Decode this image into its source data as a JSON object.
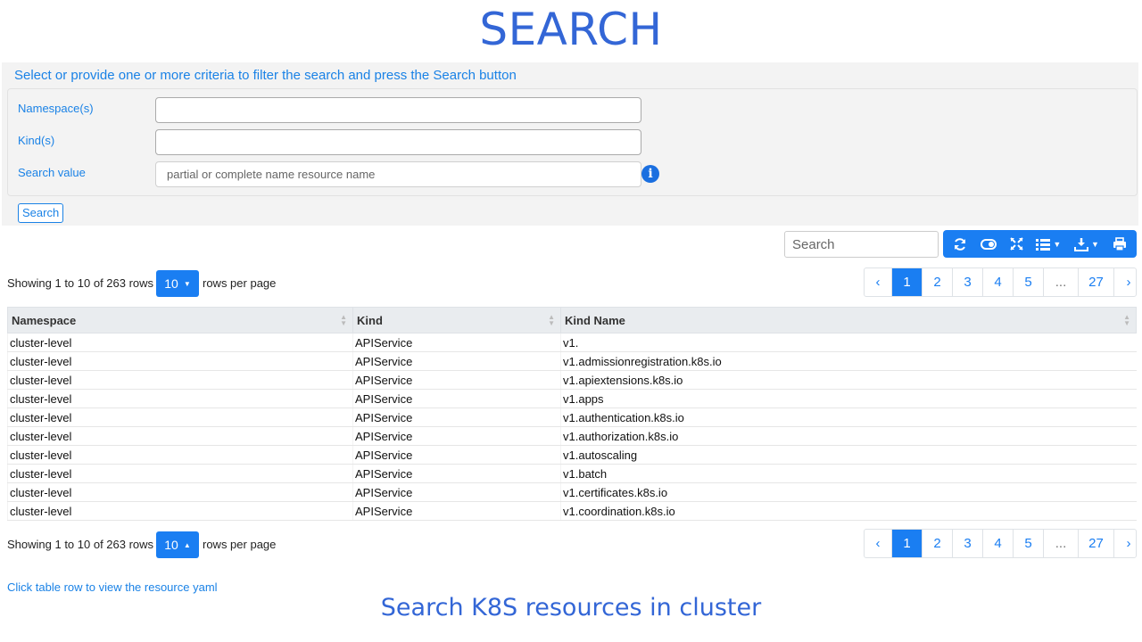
{
  "page": {
    "title": "SEARCH",
    "caption": "Search K8S resources in cluster"
  },
  "criteria": {
    "hint": "Select or provide one or more criteria to filter the search and press the Search button",
    "namespace_label": "Namespace(s)",
    "namespace_value": "",
    "kind_label": "Kind(s)",
    "kind_value": "",
    "search_value_label": "Search value",
    "search_value_placeholder": "partial or complete name resource name",
    "info_icon": "i",
    "search_button": "Search"
  },
  "toolbar": {
    "search_placeholder": "Search",
    "buttons": [
      "refresh-icon",
      "toggle-icon",
      "fullscreen-icon",
      "columns-icon",
      "export-icon",
      "print-icon"
    ],
    "accent": "#1a7ef2"
  },
  "pagination_top": {
    "info": "Showing 1 to 10 of 263 rows",
    "page_size": "10",
    "suffix": "rows per page",
    "pages": [
      "‹",
      "1",
      "2",
      "3",
      "4",
      "5",
      "...",
      "27",
      "›"
    ],
    "active_page": "1"
  },
  "pagination_bottom": {
    "info": "Showing 1 to 10 of 263 rows",
    "page_size": "10",
    "suffix": "rows per page",
    "pages": [
      "‹",
      "1",
      "2",
      "3",
      "4",
      "5",
      "...",
      "27",
      "›"
    ],
    "active_page": "1"
  },
  "table": {
    "headers": [
      "Namespace",
      "Kind",
      "Kind Name"
    ],
    "rows": [
      [
        "cluster-level",
        "APIService",
        "v1."
      ],
      [
        "cluster-level",
        "APIService",
        "v1.admissionregistration.k8s.io"
      ],
      [
        "cluster-level",
        "APIService",
        "v1.apiextensions.k8s.io"
      ],
      [
        "cluster-level",
        "APIService",
        "v1.apps"
      ],
      [
        "cluster-level",
        "APIService",
        "v1.authentication.k8s.io"
      ],
      [
        "cluster-level",
        "APIService",
        "v1.authorization.k8s.io"
      ],
      [
        "cluster-level",
        "APIService",
        "v1.autoscaling"
      ],
      [
        "cluster-level",
        "APIService",
        "v1.batch"
      ],
      [
        "cluster-level",
        "APIService",
        "v1.certificates.k8s.io"
      ],
      [
        "cluster-level",
        "APIService",
        "v1.coordination.k8s.io"
      ]
    ]
  },
  "footnote": "Click table row to view the resource yaml"
}
